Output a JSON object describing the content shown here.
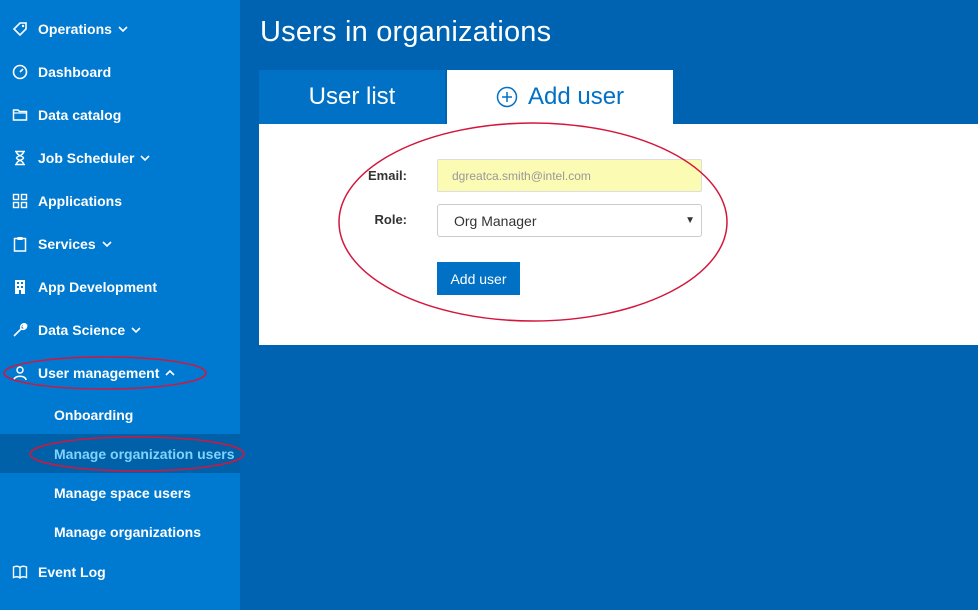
{
  "sidebar": {
    "items": [
      {
        "label": "Operations",
        "icon": "tag-icon",
        "has_chevron": true
      },
      {
        "label": "Dashboard",
        "icon": "gauge-icon"
      },
      {
        "label": "Data catalog",
        "icon": "folder-icon"
      },
      {
        "label": "Job Scheduler",
        "icon": "hourglass-icon",
        "has_chevron": true
      },
      {
        "label": "Applications",
        "icon": "grid-icon"
      },
      {
        "label": "Services",
        "icon": "clipboard-icon",
        "has_chevron": true
      },
      {
        "label": "App Development",
        "icon": "building-icon"
      },
      {
        "label": "Data Science",
        "icon": "wrench-icon",
        "has_chevron": true
      },
      {
        "label": "User management",
        "icon": "users-icon",
        "expanded": true
      },
      {
        "label": "Event Log",
        "icon": "book-icon"
      }
    ],
    "sub_items": [
      {
        "label": "Onboarding"
      },
      {
        "label": "Manage organization users",
        "active": true
      },
      {
        "label": "Manage space users"
      },
      {
        "label": "Manage organizations"
      }
    ]
  },
  "main": {
    "title": "Users in organizations",
    "tabs": [
      {
        "label": "User list"
      },
      {
        "label": "Add user",
        "icon": "plus-circle-icon",
        "active": true
      }
    ],
    "form": {
      "email_label": "Email:",
      "email_value": "dgreatca.smith@intel.com",
      "role_label": "Role:",
      "role_value": "Org Manager",
      "submit_label": "Add user"
    }
  },
  "colors": {
    "background": "#0063b1",
    "sidebar": "#0079d0",
    "accent": "#0071c5",
    "active_text": "#7fd4ff",
    "annotation": "#d4163c",
    "email_bg": "#fbfbb4"
  }
}
